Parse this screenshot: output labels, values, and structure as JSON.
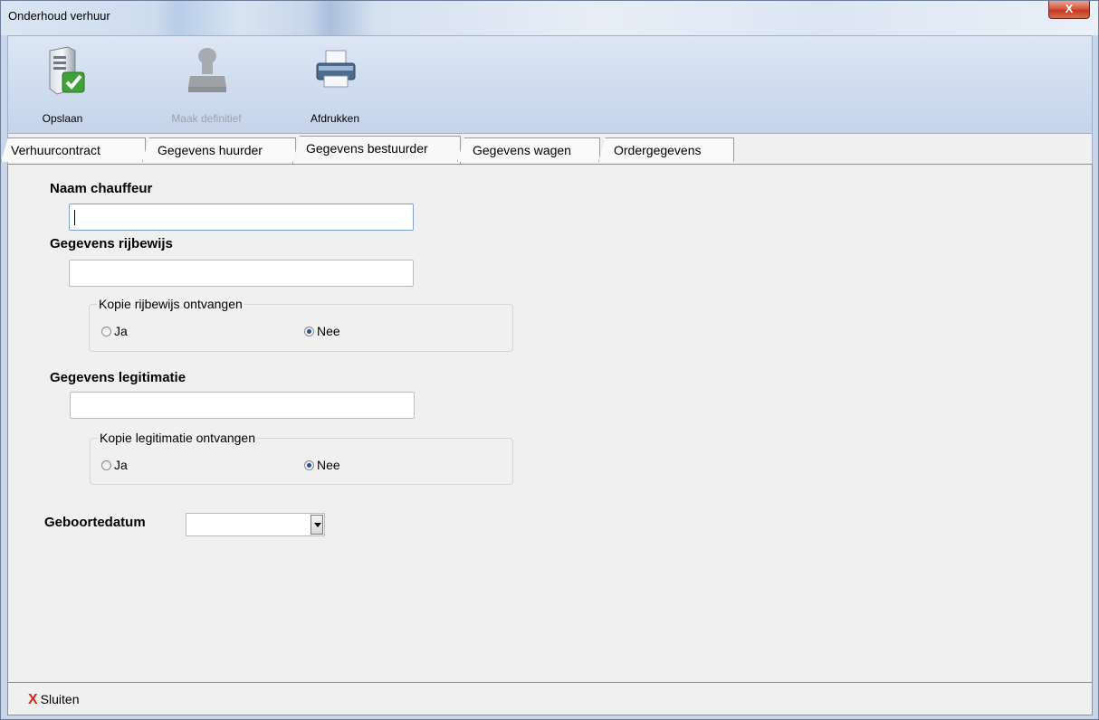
{
  "window": {
    "title": "Onderhoud verhuur",
    "close_glyph": "X"
  },
  "toolbar": {
    "buttons": [
      {
        "label": "Opslaan",
        "icon": "server-check-icon",
        "enabled": true
      },
      {
        "label": "Maak definitief",
        "icon": "stamp-icon",
        "enabled": false
      },
      {
        "label": "Afdrukken",
        "icon": "printer-icon",
        "enabled": true
      }
    ]
  },
  "tabs": [
    {
      "label": "Verhuurcontract",
      "active": false
    },
    {
      "label": "Gegevens huurder",
      "active": false
    },
    {
      "label": "Gegevens bestuurder",
      "active": true
    },
    {
      "label": "Gegevens wagen",
      "active": false
    },
    {
      "label": "Ordergegevens",
      "active": false
    }
  ],
  "form": {
    "naam_chauffeur": {
      "label": "Naam chauffeur",
      "value": ""
    },
    "rijbewijs": {
      "label": "Gegevens rijbewijs",
      "value": "",
      "kopie": {
        "legend": "Kopie rijbewijs ontvangen",
        "ja": "Ja",
        "nee": "Nee",
        "selected": "Nee"
      }
    },
    "legitimatie": {
      "label": "Gegevens legitimatie",
      "value": "",
      "kopie": {
        "legend": "Kopie legitimatie ontvangen",
        "ja": "Ja",
        "nee": "Nee",
        "selected": "Nee"
      }
    },
    "geboortedatum": {
      "label": "Geboortedatum",
      "value": ""
    }
  },
  "status": {
    "close_label": "Sluiten",
    "close_glyph": "X"
  }
}
